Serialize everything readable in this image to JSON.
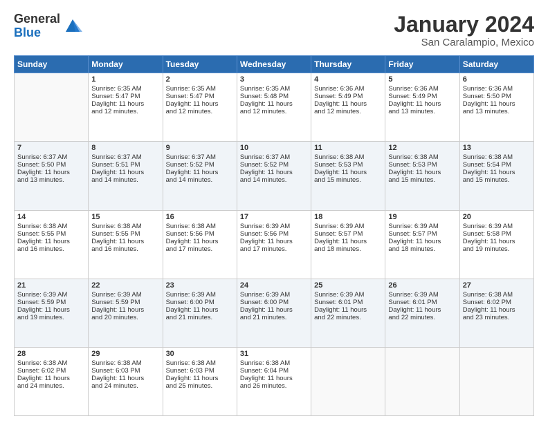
{
  "logo": {
    "general": "General",
    "blue": "Blue"
  },
  "title": "January 2024",
  "location": "San Caralampio, Mexico",
  "days_header": [
    "Sunday",
    "Monday",
    "Tuesday",
    "Wednesday",
    "Thursday",
    "Friday",
    "Saturday"
  ],
  "weeks": [
    [
      {
        "day": "",
        "lines": []
      },
      {
        "day": "1",
        "lines": [
          "Sunrise: 6:35 AM",
          "Sunset: 5:47 PM",
          "Daylight: 11 hours",
          "and 12 minutes."
        ]
      },
      {
        "day": "2",
        "lines": [
          "Sunrise: 6:35 AM",
          "Sunset: 5:47 PM",
          "Daylight: 11 hours",
          "and 12 minutes."
        ]
      },
      {
        "day": "3",
        "lines": [
          "Sunrise: 6:35 AM",
          "Sunset: 5:48 PM",
          "Daylight: 11 hours",
          "and 12 minutes."
        ]
      },
      {
        "day": "4",
        "lines": [
          "Sunrise: 6:36 AM",
          "Sunset: 5:49 PM",
          "Daylight: 11 hours",
          "and 12 minutes."
        ]
      },
      {
        "day": "5",
        "lines": [
          "Sunrise: 6:36 AM",
          "Sunset: 5:49 PM",
          "Daylight: 11 hours",
          "and 13 minutes."
        ]
      },
      {
        "day": "6",
        "lines": [
          "Sunrise: 6:36 AM",
          "Sunset: 5:50 PM",
          "Daylight: 11 hours",
          "and 13 minutes."
        ]
      }
    ],
    [
      {
        "day": "7",
        "lines": [
          "Sunrise: 6:37 AM",
          "Sunset: 5:50 PM",
          "Daylight: 11 hours",
          "and 13 minutes."
        ]
      },
      {
        "day": "8",
        "lines": [
          "Sunrise: 6:37 AM",
          "Sunset: 5:51 PM",
          "Daylight: 11 hours",
          "and 14 minutes."
        ]
      },
      {
        "day": "9",
        "lines": [
          "Sunrise: 6:37 AM",
          "Sunset: 5:52 PM",
          "Daylight: 11 hours",
          "and 14 minutes."
        ]
      },
      {
        "day": "10",
        "lines": [
          "Sunrise: 6:37 AM",
          "Sunset: 5:52 PM",
          "Daylight: 11 hours",
          "and 14 minutes."
        ]
      },
      {
        "day": "11",
        "lines": [
          "Sunrise: 6:38 AM",
          "Sunset: 5:53 PM",
          "Daylight: 11 hours",
          "and 15 minutes."
        ]
      },
      {
        "day": "12",
        "lines": [
          "Sunrise: 6:38 AM",
          "Sunset: 5:53 PM",
          "Daylight: 11 hours",
          "and 15 minutes."
        ]
      },
      {
        "day": "13",
        "lines": [
          "Sunrise: 6:38 AM",
          "Sunset: 5:54 PM",
          "Daylight: 11 hours",
          "and 15 minutes."
        ]
      }
    ],
    [
      {
        "day": "14",
        "lines": [
          "Sunrise: 6:38 AM",
          "Sunset: 5:55 PM",
          "Daylight: 11 hours",
          "and 16 minutes."
        ]
      },
      {
        "day": "15",
        "lines": [
          "Sunrise: 6:38 AM",
          "Sunset: 5:55 PM",
          "Daylight: 11 hours",
          "and 16 minutes."
        ]
      },
      {
        "day": "16",
        "lines": [
          "Sunrise: 6:38 AM",
          "Sunset: 5:56 PM",
          "Daylight: 11 hours",
          "and 17 minutes."
        ]
      },
      {
        "day": "17",
        "lines": [
          "Sunrise: 6:39 AM",
          "Sunset: 5:56 PM",
          "Daylight: 11 hours",
          "and 17 minutes."
        ]
      },
      {
        "day": "18",
        "lines": [
          "Sunrise: 6:39 AM",
          "Sunset: 5:57 PM",
          "Daylight: 11 hours",
          "and 18 minutes."
        ]
      },
      {
        "day": "19",
        "lines": [
          "Sunrise: 6:39 AM",
          "Sunset: 5:57 PM",
          "Daylight: 11 hours",
          "and 18 minutes."
        ]
      },
      {
        "day": "20",
        "lines": [
          "Sunrise: 6:39 AM",
          "Sunset: 5:58 PM",
          "Daylight: 11 hours",
          "and 19 minutes."
        ]
      }
    ],
    [
      {
        "day": "21",
        "lines": [
          "Sunrise: 6:39 AM",
          "Sunset: 5:59 PM",
          "Daylight: 11 hours",
          "and 19 minutes."
        ]
      },
      {
        "day": "22",
        "lines": [
          "Sunrise: 6:39 AM",
          "Sunset: 5:59 PM",
          "Daylight: 11 hours",
          "and 20 minutes."
        ]
      },
      {
        "day": "23",
        "lines": [
          "Sunrise: 6:39 AM",
          "Sunset: 6:00 PM",
          "Daylight: 11 hours",
          "and 21 minutes."
        ]
      },
      {
        "day": "24",
        "lines": [
          "Sunrise: 6:39 AM",
          "Sunset: 6:00 PM",
          "Daylight: 11 hours",
          "and 21 minutes."
        ]
      },
      {
        "day": "25",
        "lines": [
          "Sunrise: 6:39 AM",
          "Sunset: 6:01 PM",
          "Daylight: 11 hours",
          "and 22 minutes."
        ]
      },
      {
        "day": "26",
        "lines": [
          "Sunrise: 6:39 AM",
          "Sunset: 6:01 PM",
          "Daylight: 11 hours",
          "and 22 minutes."
        ]
      },
      {
        "day": "27",
        "lines": [
          "Sunrise: 6:38 AM",
          "Sunset: 6:02 PM",
          "Daylight: 11 hours",
          "and 23 minutes."
        ]
      }
    ],
    [
      {
        "day": "28",
        "lines": [
          "Sunrise: 6:38 AM",
          "Sunset: 6:02 PM",
          "Daylight: 11 hours",
          "and 24 minutes."
        ]
      },
      {
        "day": "29",
        "lines": [
          "Sunrise: 6:38 AM",
          "Sunset: 6:03 PM",
          "Daylight: 11 hours",
          "and 24 minutes."
        ]
      },
      {
        "day": "30",
        "lines": [
          "Sunrise: 6:38 AM",
          "Sunset: 6:03 PM",
          "Daylight: 11 hours",
          "and 25 minutes."
        ]
      },
      {
        "day": "31",
        "lines": [
          "Sunrise: 6:38 AM",
          "Sunset: 6:04 PM",
          "Daylight: 11 hours",
          "and 26 minutes."
        ]
      },
      {
        "day": "",
        "lines": []
      },
      {
        "day": "",
        "lines": []
      },
      {
        "day": "",
        "lines": []
      }
    ]
  ]
}
